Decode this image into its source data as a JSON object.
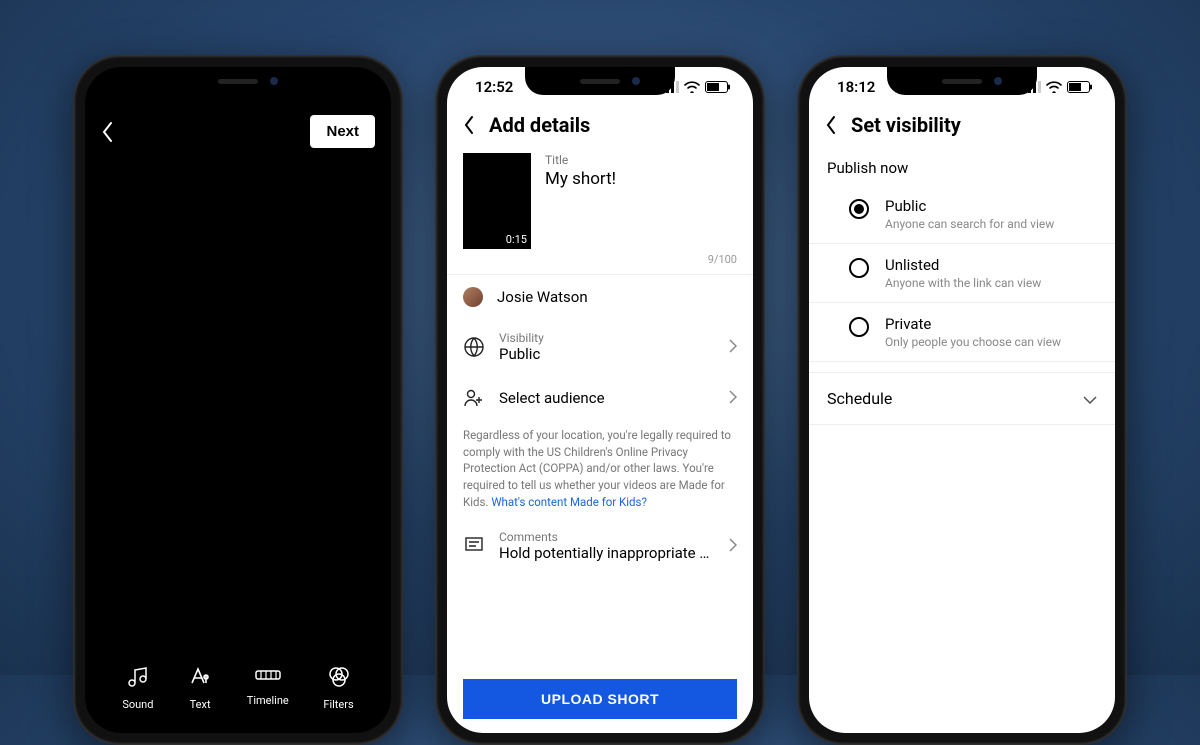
{
  "phone1": {
    "next_label": "Next",
    "tools": {
      "sound": "Sound",
      "text": "Text",
      "timeline": "Timeline",
      "filters": "Filters"
    }
  },
  "phone2": {
    "status_time": "12:52",
    "header": "Add details",
    "title_label": "Title",
    "title_value": "My short!",
    "duration": "0:15",
    "char_count": "9/100",
    "user_name": "Josie Watson",
    "visibility_label": "Visibility",
    "visibility_value": "Public",
    "audience_label": "Select audience",
    "legal_text": "Regardless of your location, you're legally required to comply with the US Children's Online Privacy Protection Act (COPPA) and/or other laws. You're required to tell us whether your videos are Made for Kids. ",
    "legal_link": "What's content Made for Kids?",
    "comments_label": "Comments",
    "comments_value": "Hold potentially inappropriate com…",
    "upload_label": "UPLOAD SHORT"
  },
  "phone3": {
    "status_time": "18:12",
    "header": "Set visibility",
    "publish_now": "Publish now",
    "options": {
      "public": {
        "title": "Public",
        "sub": "Anyone can search for and view"
      },
      "unlisted": {
        "title": "Unlisted",
        "sub": "Anyone with the link can view"
      },
      "private": {
        "title": "Private",
        "sub": "Only people you choose can view"
      }
    },
    "schedule": "Schedule"
  }
}
